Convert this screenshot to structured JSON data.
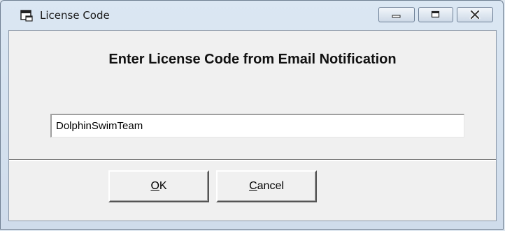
{
  "window": {
    "title": "License Code",
    "controls": {
      "minimize_icon": "minimize-icon",
      "maximize_icon": "maximize-icon",
      "close_icon": "close-icon"
    }
  },
  "dialog": {
    "heading": "Enter License Code from Email Notification",
    "license_input": {
      "value": "DolphinSwimTeam"
    }
  },
  "buttons": {
    "ok": {
      "mnemonic": "O",
      "rest": "K"
    },
    "cancel": {
      "mnemonic": "C",
      "rest": "ancel"
    }
  },
  "colors": {
    "title_bar": "#dbe7f3",
    "client_background": "#f0f0f0",
    "input_background": "#ffffff"
  }
}
